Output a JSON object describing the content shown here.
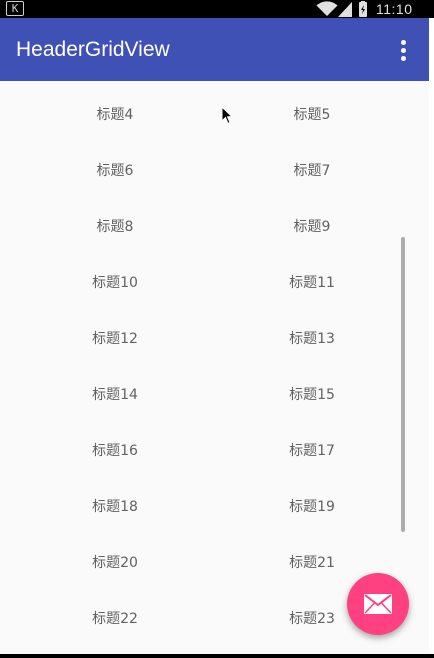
{
  "status_bar": {
    "left_badge": "K",
    "time": "11:10",
    "icons": [
      "wifi-icon",
      "signal-icon",
      "battery-icon"
    ]
  },
  "app_bar": {
    "title": "HeaderGridView",
    "background": "#3f51b5",
    "menu_icon": "more-vert-icon"
  },
  "grid": {
    "rows": [
      [
        "标题4",
        "标题5"
      ],
      [
        "标题6",
        "标题7"
      ],
      [
        "标题8",
        "标题9"
      ],
      [
        "标题10",
        "标题11"
      ],
      [
        "标题12",
        "标题13"
      ],
      [
        "标题14",
        "标题15"
      ],
      [
        "标题16",
        "标题17"
      ],
      [
        "标题18",
        "标题19"
      ],
      [
        "标题20",
        "标题21"
      ],
      [
        "标题22",
        "标题23"
      ]
    ]
  },
  "fab": {
    "icon": "email-icon",
    "color": "#ff4081"
  }
}
